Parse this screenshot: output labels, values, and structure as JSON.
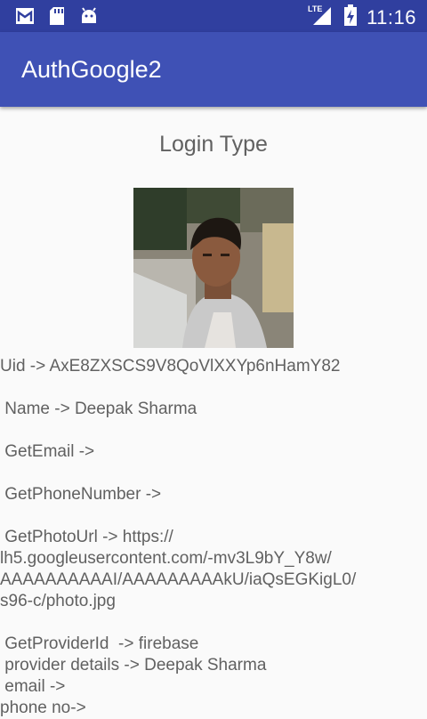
{
  "status_bar": {
    "time": "11:16",
    "network": "LTE",
    "left_icons": [
      "gmail-icon",
      "sd-card-icon",
      "android-icon"
    ],
    "right_icons": [
      "signal-icon",
      "battery-charging-icon"
    ]
  },
  "app_bar": {
    "title": "AuthGoogle2",
    "color": "#3f51b5",
    "status_color": "#303f9f"
  },
  "main": {
    "heading": "Login Type",
    "uid": "Uid -> AxE8ZXSCS9V8QoVlXXYp6nHamY82",
    "name": " Name -> Deepak Sharma",
    "email": " GetEmail ->",
    "phone": " GetPhoneNumber ->",
    "photo_url_1": " GetPhotoUrl -> https://",
    "photo_url_2": "lh5.googleusercontent.com/-mv3L9bY_Y8w/",
    "photo_url_3": "AAAAAAAAAAI/AAAAAAAAAkU/iaQsEGKigL0/",
    "photo_url_4": "s96-c/photo.jpg",
    "provider_id": " GetProviderId  -> firebase",
    "provider_details": " provider details -> Deepak Sharma",
    "provider_email": " email ->",
    "provider_phone": "phone no->"
  }
}
